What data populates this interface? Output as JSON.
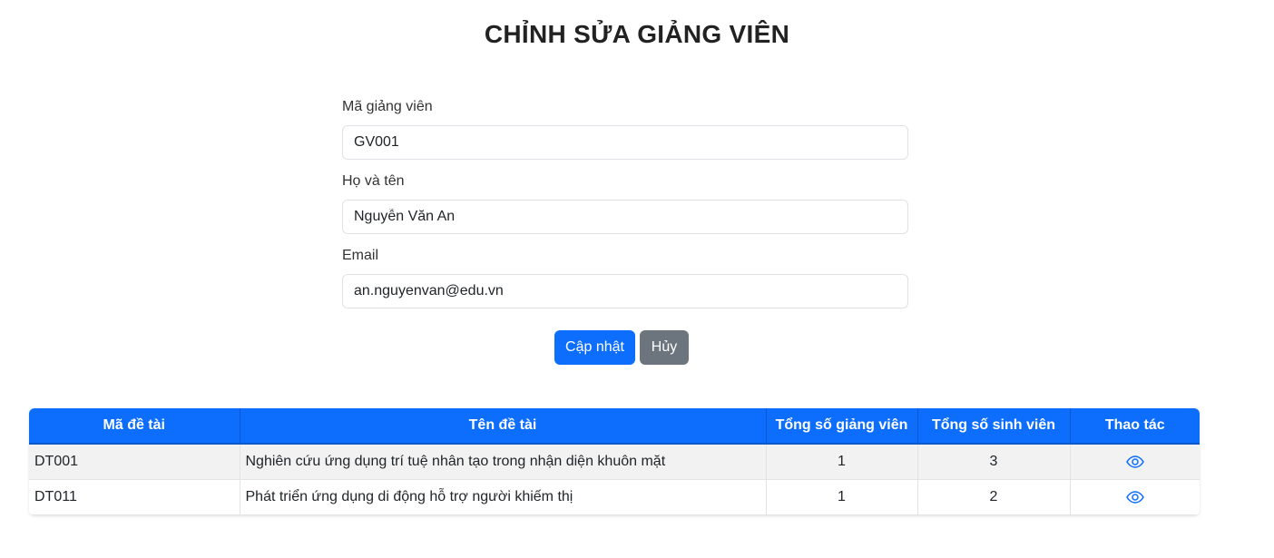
{
  "page": {
    "title": "CHỈNH SỬA GIẢNG VIÊN"
  },
  "form": {
    "code": {
      "label": "Mã giảng viên",
      "value": "GV001"
    },
    "name": {
      "label": "Họ và tên",
      "value": "Nguyễn Văn An"
    },
    "email": {
      "label": "Email",
      "value": "an.nguyenvan@edu.vn"
    },
    "update_label": "Cập nhật",
    "cancel_label": "Hủy"
  },
  "table": {
    "headers": [
      "Mã đề tài",
      "Tên đề tài",
      "Tổng số giảng viên",
      "Tổng số sinh viên",
      "Thao tác"
    ],
    "rows": [
      {
        "code": "DT001",
        "title": "Nghiên cứu ứng dụng trí tuệ nhân tạo trong nhận diện khuôn mặt",
        "lecturers": "1",
        "students": "3",
        "action_icon": "eye-icon"
      },
      {
        "code": "DT011",
        "title": "Phát triển ứng dụng di động hỗ trợ người khiếm thị",
        "lecturers": "1",
        "students": "2",
        "action_icon": "eye-icon"
      }
    ]
  },
  "colors": {
    "primary": "#0d6efd",
    "secondary": "#6c757d",
    "row_stripe": "#f2f2f2"
  }
}
